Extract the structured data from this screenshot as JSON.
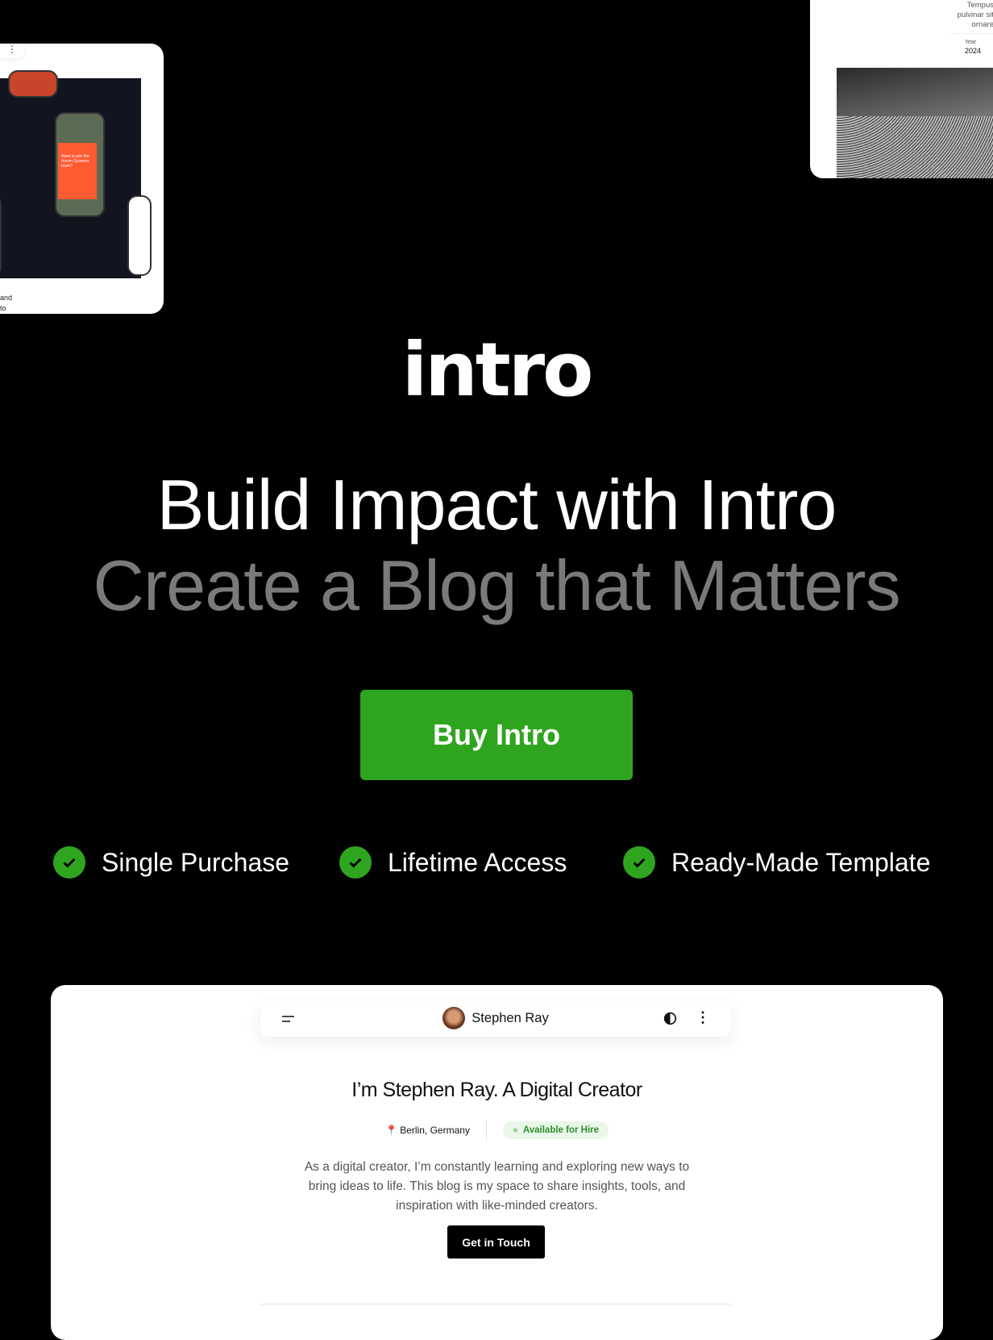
{
  "preview_left": {
    "text_lines": [
      "and",
      "to"
    ],
    "phone_card_text": "Want to join the Ascon Systems team?"
  },
  "preview_right": {
    "text_lines": [
      "Tempus",
      "pulvinar sit",
      "ornare"
    ],
    "year_label": "Year",
    "year_value": "2024"
  },
  "logo": "intro",
  "headline": {
    "line1": "Build Impact with Intro",
    "line2": "Create a Blog that Matters"
  },
  "buy_button": "Buy Intro",
  "features": [
    {
      "label": "Single Purchase",
      "icon": "check-circle-icon"
    },
    {
      "label": "Lifetime Access",
      "icon": "check-circle-icon"
    },
    {
      "label": "Ready-Made Template",
      "icon": "check-circle-icon"
    }
  ],
  "demo": {
    "nav": {
      "name": "Stephen Ray",
      "menu_icon": "menu-icon",
      "theme_icon": "contrast-icon",
      "more_icon": "more-vertical-icon"
    },
    "title": "I’m Stephen Ray. A Digital Creator",
    "location": "Berlin, Germany",
    "status": "Available for Hire",
    "bio_lines": [
      "As a digital creator, I’m constantly learning and exploring new ways to",
      "bring ideas to life. This blog is my space to share insights, tools, and",
      "inspiration with like-minded creators."
    ],
    "cta": "Get in Touch"
  },
  "colors": {
    "accent": "#2fa51f",
    "headline_secondary": "#7a7a7a",
    "status_text": "#2e8b2e"
  }
}
